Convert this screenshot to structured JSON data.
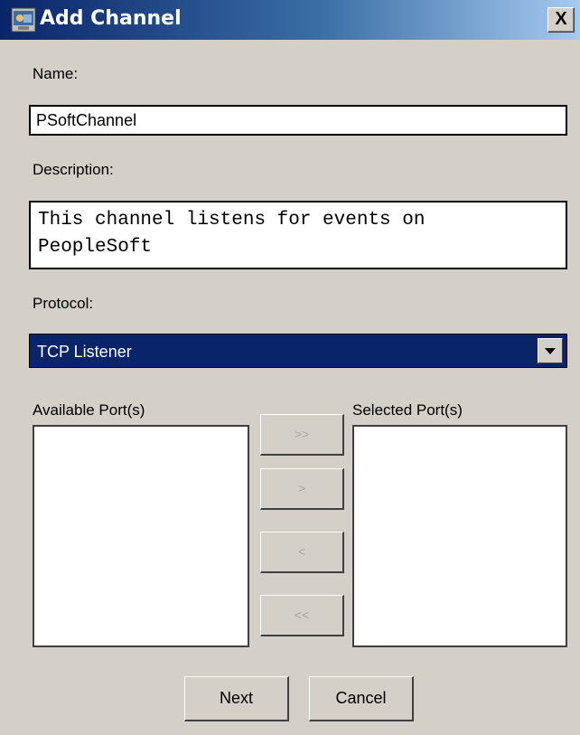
{
  "window": {
    "title": "Add Channel",
    "close_label": "X"
  },
  "form": {
    "name_label": "Name:",
    "name_value": "PSoftChannel",
    "description_label": "Description:",
    "description_value": "This channel listens for events on\nPeopleSoft",
    "protocol_label": "Protocol:",
    "protocol_value": "TCP Listener"
  },
  "ports": {
    "available_label": "Available Port(s)",
    "selected_label": "Selected Port(s)",
    "available_items": [],
    "selected_items": [],
    "buttons": {
      "add_all": ">>",
      "add": ">",
      "remove": "<",
      "remove_all": "<<"
    }
  },
  "footer": {
    "next_label": "Next",
    "cancel_label": "Cancel"
  },
  "colors": {
    "title_bar": "#0a246a",
    "dialog_bg": "#d4d0c8",
    "selection": "#0a246a",
    "disabled_text": "#a9a6a0"
  }
}
